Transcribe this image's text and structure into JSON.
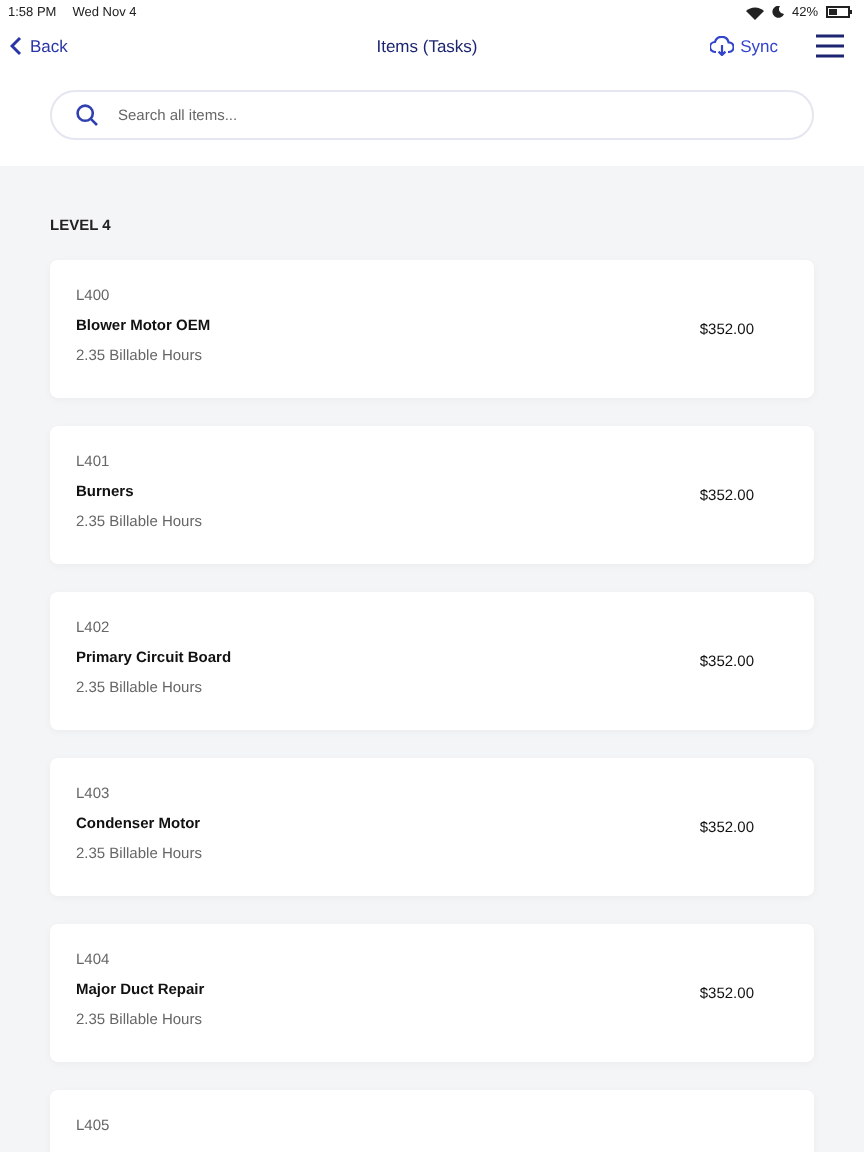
{
  "status_bar": {
    "time": "1:58 PM",
    "date": "Wed Nov 4",
    "battery_text": "42%"
  },
  "nav": {
    "back": "Back",
    "title": "Items (Tasks)",
    "sync": "Sync"
  },
  "search": {
    "placeholder": "Search all items..."
  },
  "section": {
    "title": "LEVEL 4"
  },
  "items": [
    {
      "code": "L400",
      "name": "Blower Motor OEM",
      "hours": "2.35 Billable Hours",
      "price": "$352.00"
    },
    {
      "code": "L401",
      "name": "Burners",
      "hours": "2.35 Billable Hours",
      "price": "$352.00"
    },
    {
      "code": "L402",
      "name": "Primary Circuit Board",
      "hours": "2.35 Billable Hours",
      "price": "$352.00"
    },
    {
      "code": "L403",
      "name": "Condenser Motor",
      "hours": "2.35 Billable Hours",
      "price": "$352.00"
    },
    {
      "code": "L404",
      "name": "Major Duct Repair",
      "hours": "2.35 Billable Hours",
      "price": "$352.00"
    },
    {
      "code": "L405"
    }
  ]
}
